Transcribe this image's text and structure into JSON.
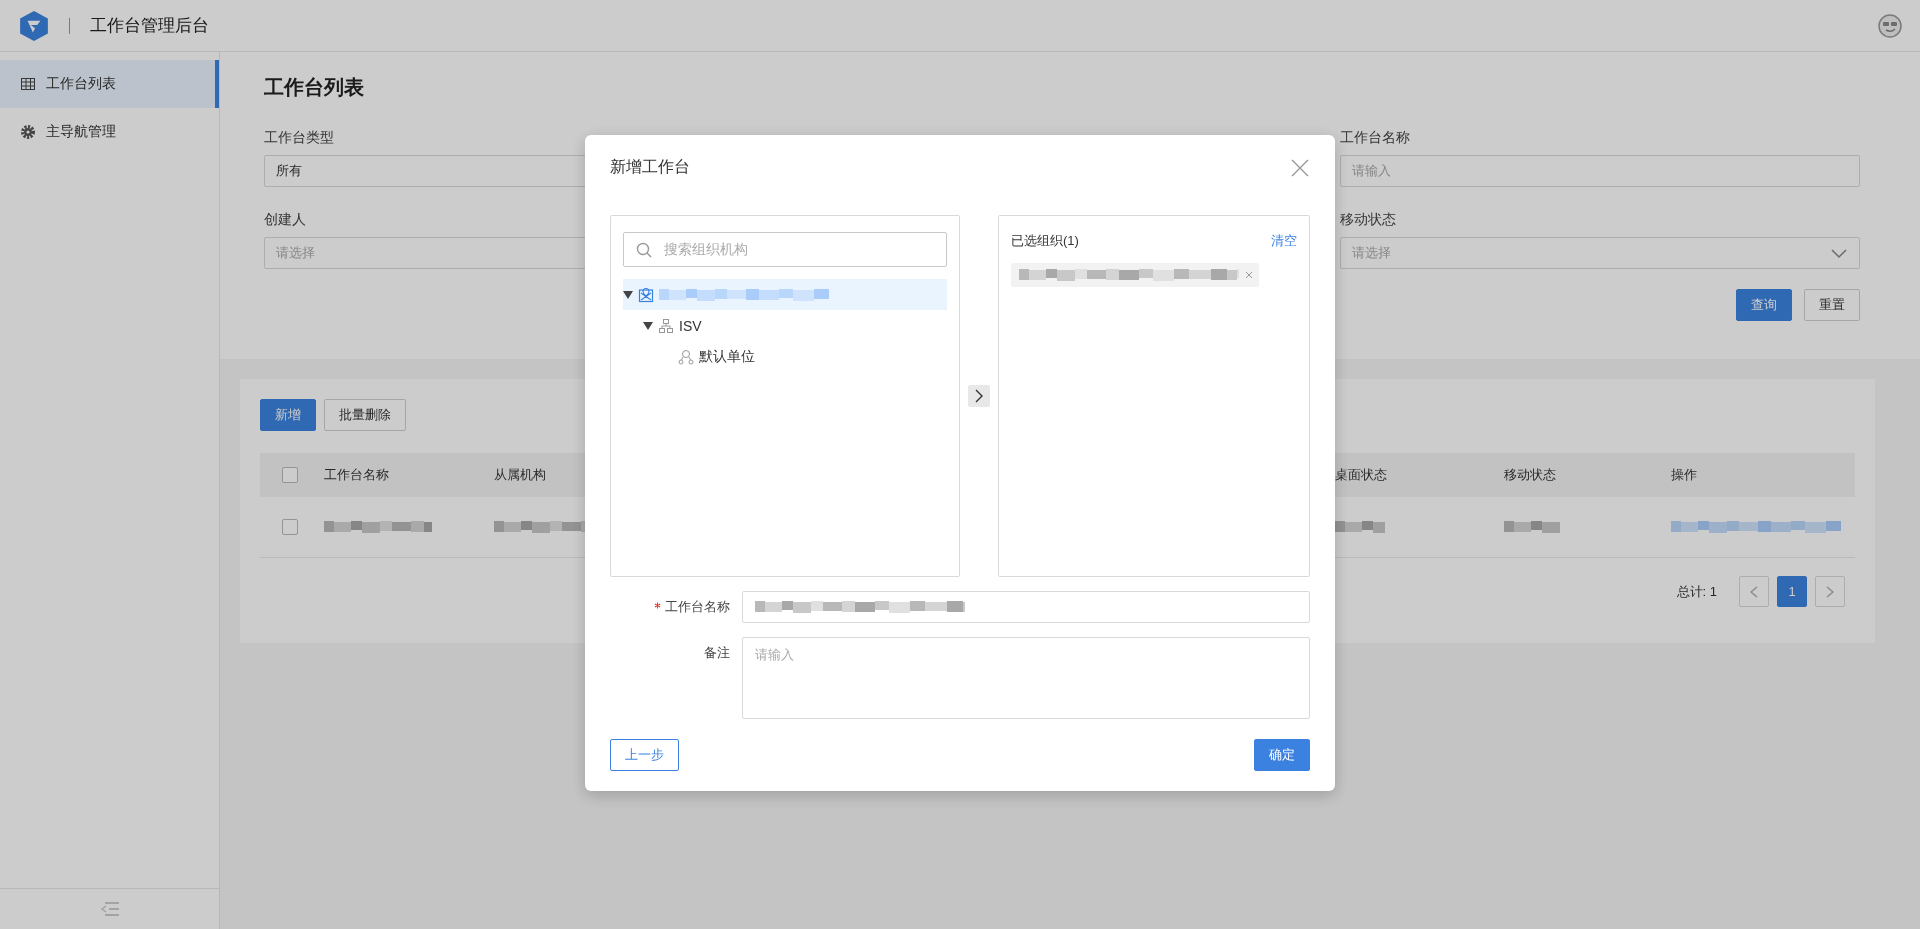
{
  "header": {
    "title": "工作台管理后台"
  },
  "sidebar": {
    "items": [
      {
        "label": "工作台列表",
        "selected": true
      },
      {
        "label": "主导航管理",
        "selected": false
      }
    ]
  },
  "page": {
    "title": "工作台列表"
  },
  "filters": [
    {
      "label": "工作台类型",
      "kind": "input",
      "value": "所有"
    },
    {
      "label": "工作台名称",
      "kind": "input",
      "placeholder": "请输入"
    },
    {
      "label": "创建人",
      "kind": "input",
      "placeholder": "请选择"
    },
    {
      "label": "移动状态",
      "kind": "select",
      "placeholder": "请选择"
    }
  ],
  "filter_buttons": [
    {
      "label": "查询",
      "kind": "primary"
    },
    {
      "label": "重置",
      "kind": "default"
    }
  ],
  "toolbar": [
    {
      "label": "新增",
      "kind": "primary"
    },
    {
      "label": "批量删除",
      "kind": "default"
    }
  ],
  "table": {
    "header_checked": false,
    "columns": [
      "工作台名称",
      "从属机构",
      "桌面状态",
      "移动状态",
      "操作"
    ],
    "rows": [
      {
        "checked": false,
        "cells": [
          {
            "kind": "blurred"
          },
          {
            "kind": "blurred"
          },
          {
            "kind": "blurred"
          },
          {
            "kind": "blurred"
          },
          {
            "kind": "blurred"
          }
        ]
      }
    ]
  },
  "pagination": {
    "total": "总计: 1",
    "pages": [
      {
        "label": "1",
        "selected": true
      }
    ]
  },
  "modal": {
    "title": "新增工作台",
    "search": {
      "placeholder": "搜索组织机构"
    },
    "tree": [
      {
        "kind": "blurred",
        "selected": true,
        "expanded": true,
        "children": [
          {
            "label": "ISV",
            "selected": false,
            "expanded": true,
            "children": [
              {
                "label": "默认单位",
                "selected": false
              }
            ]
          }
        ]
      }
    ],
    "selected_panel": {
      "title": "已选组织(1)",
      "clear": "清空",
      "tags": [
        {
          "kind": "blurred"
        }
      ]
    },
    "form": [
      {
        "label": "工作台名称",
        "required": true,
        "kind": "blurred-input"
      },
      {
        "label": "备注",
        "required": false,
        "kind": "textarea",
        "placeholder": "请输入"
      }
    ],
    "buttons": [
      {
        "label": "上一步",
        "kind": "outline"
      },
      {
        "label": "确定",
        "kind": "primary"
      }
    ]
  }
}
